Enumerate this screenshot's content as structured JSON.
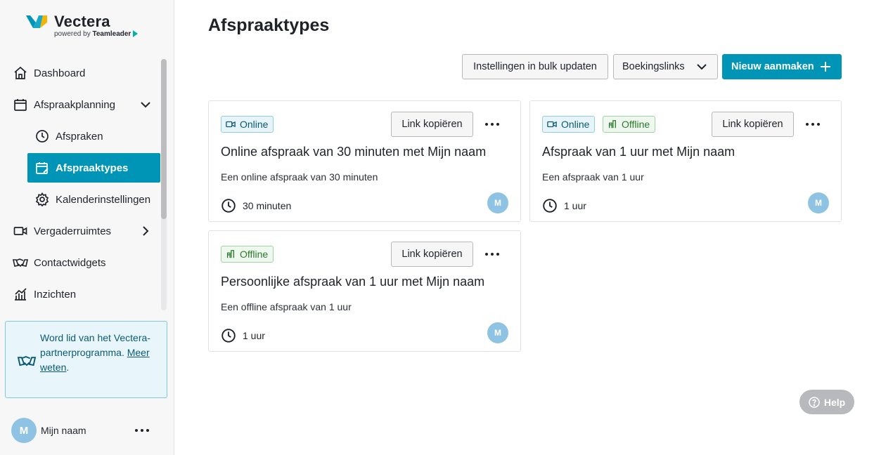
{
  "brand": {
    "name": "Vectera",
    "powered_by": "powered by",
    "powered_by_brand": "Teamleader",
    "colors": {
      "primary": "#0095b6",
      "online": "#0b5a73",
      "offline": "#2b7a2b",
      "avatar": "#8fc3e3"
    }
  },
  "sidebar": {
    "items": [
      {
        "label": "Dashboard",
        "icon": "home-icon"
      },
      {
        "label": "Afspraakplanning",
        "icon": "calendar-icon",
        "expanded": true
      },
      {
        "label": "Afspraken",
        "icon": "clock-icon"
      },
      {
        "label": "Afspraaktypes",
        "icon": "calendar-edit-icon",
        "active": true
      },
      {
        "label": "Kalenderinstellingen",
        "icon": "gear-icon"
      },
      {
        "label": "Vergaderruimtes",
        "icon": "video-icon",
        "expanded": false
      },
      {
        "label": "Contactwidgets",
        "icon": "handshake-icon"
      },
      {
        "label": "Inzichten",
        "icon": "chart-icon"
      }
    ],
    "partner": {
      "text": "Word lid van het Vectera-partnerprogramma.",
      "link": "Meer weten",
      "link_suffix": "."
    },
    "user": {
      "initial": "M",
      "name": "Mijn naam"
    }
  },
  "main": {
    "title": "Afspraaktypes",
    "toolbar": {
      "bulk_label": "Instellingen in bulk updaten",
      "links_label": "Boekingslinks",
      "new_label": "Nieuw aanmaken"
    },
    "cards": [
      {
        "tags": [
          {
            "label": "Online",
            "type": "online"
          }
        ],
        "copy_label": "Link kopiëren",
        "title": "Online afspraak van 30 minuten met Mijn naam",
        "description": "Een online afspraak van 30 minuten",
        "duration": "30 minuten",
        "avatar": "M"
      },
      {
        "tags": [
          {
            "label": "Online",
            "type": "online"
          },
          {
            "label": "Offline",
            "type": "offline"
          }
        ],
        "copy_label": "Link kopiëren",
        "title": "Afspraak van 1 uur met Mijn naam",
        "description": "Een afspraak van 1 uur",
        "duration": "1 uur",
        "avatar": "M"
      },
      {
        "tags": [
          {
            "label": "Offline",
            "type": "offline"
          }
        ],
        "copy_label": "Link kopiëren",
        "title": "Persoonlijke afspraak van 1 uur met Mijn naam",
        "description": "Een offline afspraak van 1 uur",
        "duration": "1 uur",
        "avatar": "M"
      }
    ]
  },
  "help": {
    "label": "Help"
  }
}
